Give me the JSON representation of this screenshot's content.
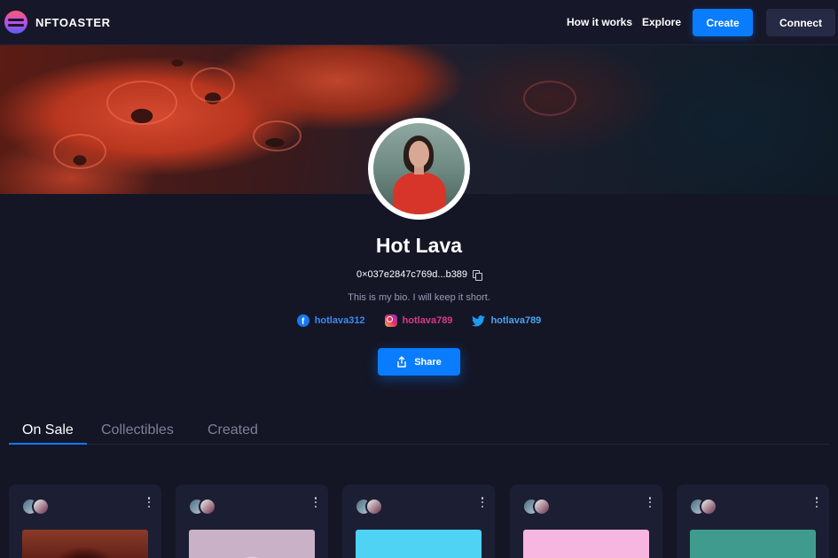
{
  "nav": {
    "logo_text": "NFTOASTER",
    "how_it_works": "How it works",
    "explore": "Explore",
    "create": "Create",
    "connect": "Connect"
  },
  "profile": {
    "name": "Hot Lava",
    "wallet": "0×037e2847c769d...b389",
    "bio": "This is my bio. I will keep it short.",
    "socials": [
      {
        "platform": "facebook",
        "handle": "hotlava312",
        "icon": "facebook-icon"
      },
      {
        "platform": "instagram",
        "handle": "hotlava789",
        "icon": "instagram-icon"
      },
      {
        "platform": "twitter",
        "handle": "hotlava789",
        "icon": "twitter-icon"
      }
    ],
    "share_label": "Share"
  },
  "tabs": [
    {
      "label": "On Sale",
      "active": true
    },
    {
      "label": "Collectibles",
      "active": false
    },
    {
      "label": "Created",
      "active": false
    }
  ],
  "cards": [
    {
      "thumb_color": "#7a2a1e"
    },
    {
      "thumb_color": "#c9b2c8"
    },
    {
      "thumb_color": "#4fd3f5"
    },
    {
      "thumb_color": "#f7b6e0"
    },
    {
      "thumb_color": "#3f9b8e"
    }
  ],
  "colors": {
    "accent": "#0a7cff",
    "background": "#141626",
    "card": "#1c1f33"
  }
}
